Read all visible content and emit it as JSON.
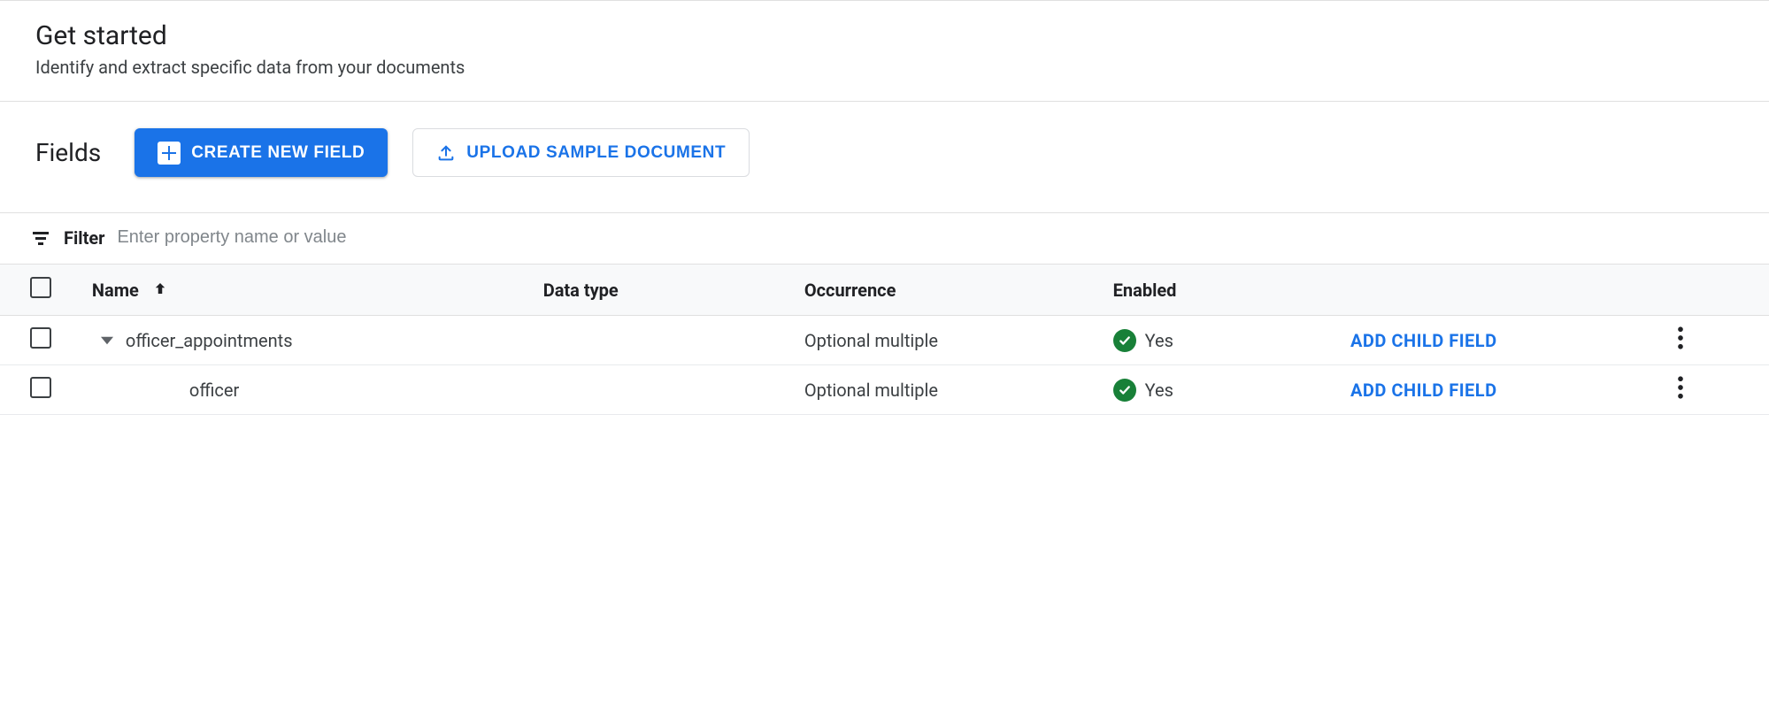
{
  "header": {
    "title": "Get started",
    "subtitle": "Identify and extract specific data from your documents"
  },
  "fieldsBar": {
    "label": "Fields",
    "create_label": "Create New Field",
    "upload_label": "Upload Sample Document"
  },
  "filter": {
    "label": "Filter",
    "placeholder": "Enter property name or value"
  },
  "table": {
    "columns": {
      "name": "Name",
      "datatype": "Data type",
      "occurrence": "Occurrence",
      "enabled": "Enabled"
    },
    "add_child_label": "ADD CHILD FIELD",
    "rows": [
      {
        "name": "officer_appointments",
        "datatype": "",
        "occurrence": "Optional multiple",
        "enabled": "Yes",
        "indent": 0,
        "expandable": true
      },
      {
        "name": "officer",
        "datatype": "",
        "occurrence": "Optional multiple",
        "enabled": "Yes",
        "indent": 1,
        "expandable": false
      }
    ]
  }
}
